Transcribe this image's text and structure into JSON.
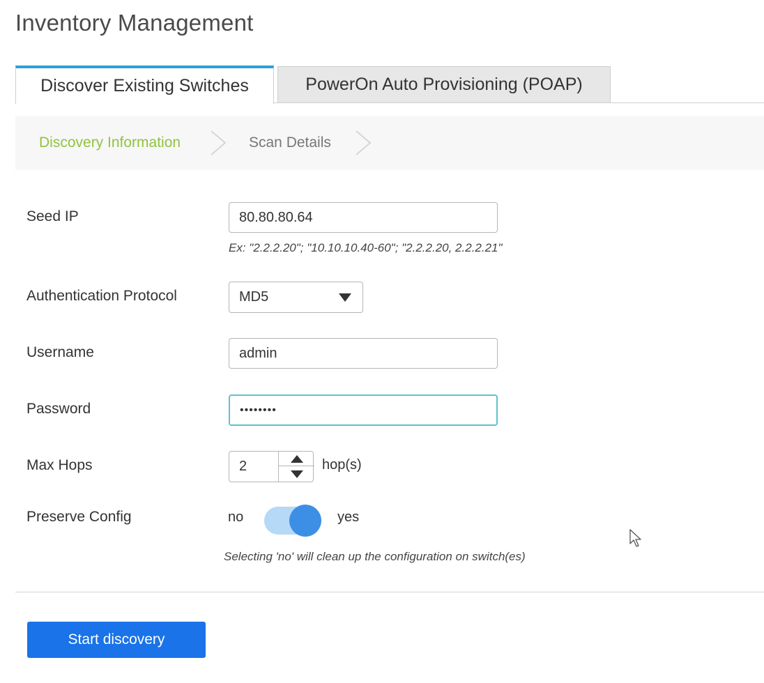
{
  "page": {
    "title": "Inventory Management"
  },
  "tabs": [
    {
      "label": "Discover Existing Switches",
      "active": true
    },
    {
      "label": "PowerOn Auto Provisioning (POAP)",
      "active": false
    }
  ],
  "steps": [
    {
      "label": "Discovery Information",
      "active": true
    },
    {
      "label": "Scan Details",
      "active": false
    }
  ],
  "form": {
    "seed_ip": {
      "label": "Seed IP",
      "value": "80.80.80.64",
      "hint": "Ex: \"2.2.2.20\"; \"10.10.10.40-60\"; \"2.2.2.20, 2.2.2.21\""
    },
    "auth_protocol": {
      "label": "Authentication Protocol",
      "value": "MD5"
    },
    "username": {
      "label": "Username",
      "value": "admin"
    },
    "password": {
      "label": "Password",
      "value": "••••••••"
    },
    "max_hops": {
      "label": "Max Hops",
      "value": "2",
      "unit": "hop(s)"
    },
    "preserve_config": {
      "label": "Preserve Config",
      "off_label": "no",
      "on_label": "yes",
      "state": "yes",
      "hint": "Selecting 'no' will clean up the configuration on switch(es)"
    }
  },
  "actions": {
    "start_label": "Start discovery"
  },
  "colors": {
    "accent": "#1a73e8",
    "tab_border": "#2d9fd9",
    "step_active": "#8fc43f",
    "toggle": "#3d8fe6",
    "focus": "#5ec2cf"
  }
}
